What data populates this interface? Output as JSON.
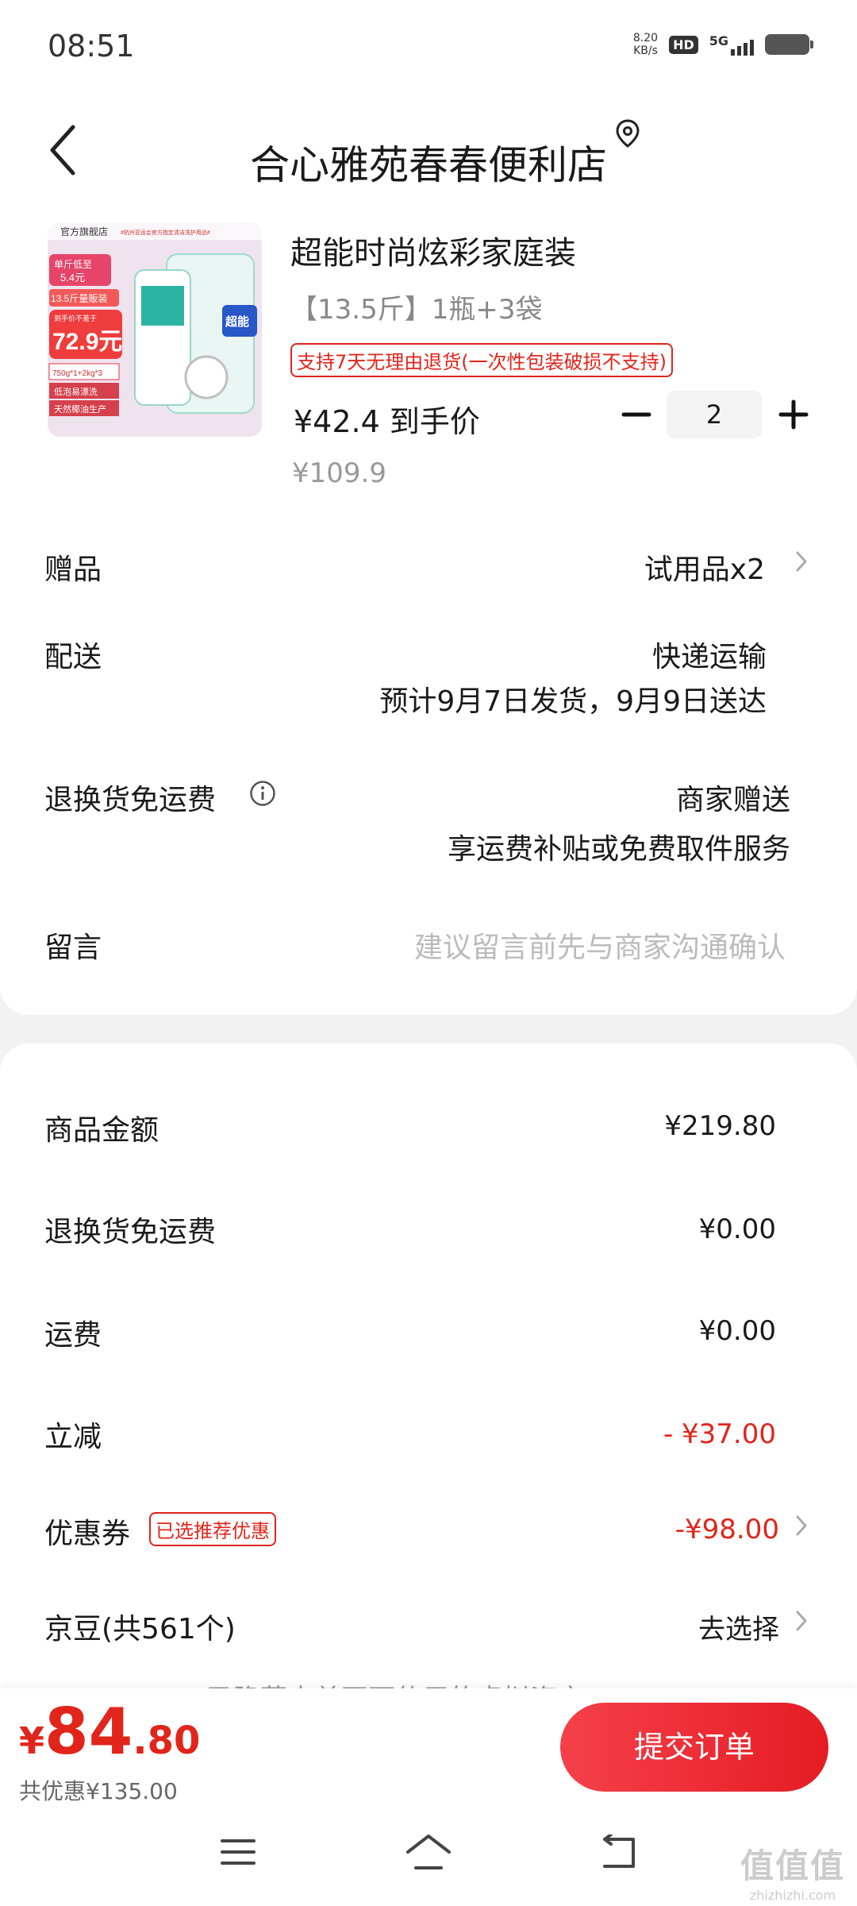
{
  "status_bar": {
    "time": "08:51",
    "net_speed_value": "8.20",
    "net_speed_unit": "KB/s",
    "hd": "HD",
    "signal": "5G"
  },
  "header": {
    "store_name": "合心雅苑春春便利店"
  },
  "product": {
    "title": "超能时尚炫彩家庭装",
    "spec": "【13.5斤】1瓶+3袋",
    "return_policy": "支持7天无理由退货(一次性包装破损不支持)",
    "price": "¥42.4 到手价",
    "original_price": "¥109.9",
    "quantity": "2",
    "image": {
      "store_label": "官方旗舰店",
      "banner": "#杭州亚运会官方指定清洁洗护用品#",
      "unit_price_line1": "单斤低至",
      "unit_price_line2": "5.4元",
      "pack_label": "13.5斤量贩装",
      "promo": "到手价不差于",
      "price": "72.9元",
      "spec": "750g*1+2kg*3",
      "feature1": "低泡易漂洗",
      "feature2": "天然椰油生产",
      "brand": "超能"
    }
  },
  "rows": {
    "gift_label": "赠品",
    "gift_value": "试用品x2",
    "delivery_label": "配送",
    "delivery_method": "快递运输",
    "delivery_estimate": "预计9月7日发货，9月9日送达",
    "return_shipping_label": "退换货免运费",
    "return_shipping_value": "商家赠送",
    "return_shipping_desc": "享运费补贴或免费取件服务",
    "message_label": "留言",
    "message_placeholder": "建议留言前先与商家沟通确认"
  },
  "summary": {
    "goods_amount_label": "商品金额",
    "goods_amount": "¥219.80",
    "return_fee_label": "退换货免运费",
    "return_fee": "¥0.00",
    "shipping_label": "运费",
    "shipping": "¥0.00",
    "discount_label": "立减",
    "discount": "- ¥37.00",
    "coupon_label": "优惠券",
    "coupon_badge": "已选推荐优惠",
    "coupon": "-¥98.00",
    "jd_beans_label": "京豆(共561个)",
    "jd_beans_action": "去选择",
    "hidden_hint": "已隐藏本单不可使用的虚拟资产"
  },
  "footer": {
    "total_currency": "¥",
    "total_int": "84",
    "total_dec": ".80",
    "saved": "共优惠¥135.00",
    "submit": "提交订单"
  },
  "watermark": {
    "main": "值值值",
    "site": "zhizhizhi.com"
  },
  "colors": {
    "accent_red": "#e1251b",
    "muted_text": "#999999",
    "background": "#f2f2f2"
  },
  "icons": [
    "back-icon",
    "location-icon",
    "minus-icon",
    "plus-icon",
    "chevron-right-icon",
    "info-icon",
    "menu-icon",
    "home-icon",
    "back-nav-icon"
  ]
}
